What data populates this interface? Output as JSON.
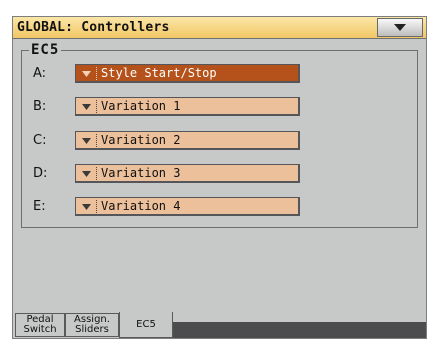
{
  "window": {
    "title": "GLOBAL: Controllers",
    "menu_icon": "triangle-down-icon"
  },
  "group": {
    "legend": "EC5"
  },
  "rows": [
    {
      "label": "A:",
      "value": "Style Start/Stop",
      "selected": true
    },
    {
      "label": "B:",
      "value": "Variation 1",
      "selected": false
    },
    {
      "label": "C:",
      "value": "Variation 2",
      "selected": false
    },
    {
      "label": "D:",
      "value": "Variation 3",
      "selected": false
    },
    {
      "label": "E:",
      "value": "Variation 4",
      "selected": false
    }
  ],
  "tabs": [
    {
      "line1": "Pedal",
      "line2": "Switch",
      "active": false
    },
    {
      "line1": "Assign.",
      "line2": "Sliders",
      "active": false
    },
    {
      "line1": "EC5",
      "line2": "",
      "active": true
    }
  ],
  "colors": {
    "panel": "#c7c9c8",
    "titlebar": "#f1c765",
    "select": "#ebc09a",
    "select_selected": "#b5521b",
    "tab_strip": "#4c4c4e"
  }
}
